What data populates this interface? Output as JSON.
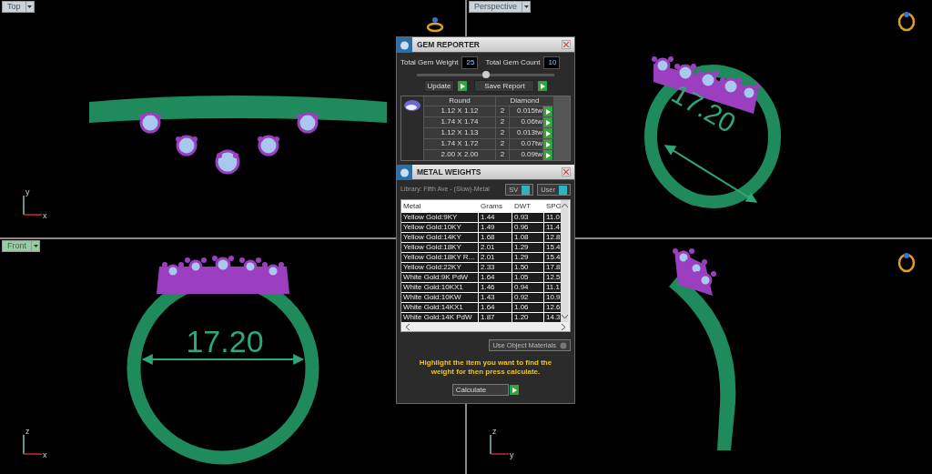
{
  "viewports": [
    {
      "kind": "top",
      "label": "Top",
      "selected": false,
      "axes": [
        "y",
        "x"
      ]
    },
    {
      "kind": "perspective",
      "label": "Perspective",
      "selected": false,
      "dimension": "17.20"
    },
    {
      "kind": "front",
      "label": "Front",
      "selected": true,
      "axes": [
        "z",
        "x"
      ],
      "dimension": "17.20"
    },
    {
      "kind": "right",
      "axes": [
        "z",
        "y"
      ]
    }
  ],
  "gem_reporter": {
    "title": "GEM REPORTER",
    "weight_label": "Total Gem Weight",
    "weight_value": "25",
    "count_label": "Total Gem Count",
    "count_value": "10",
    "slider": {
      "level": 0.5
    },
    "buttons": [
      "Update",
      "Save Report"
    ],
    "columns": [
      "Round",
      "Diamond"
    ],
    "rows": [
      {
        "size": "1.12 X 1.12",
        "count": "2",
        "weight": "0.015tw"
      },
      {
        "size": "1.74 X 1.74",
        "count": "2",
        "weight": "0.06tw"
      },
      {
        "size": "1.12 X 1.13",
        "count": "2",
        "weight": "0.013tw"
      },
      {
        "size": "1.74 X 1.72",
        "count": "2",
        "weight": "0.07tw"
      },
      {
        "size": "2.00 X 2.00",
        "count": "2",
        "weight": "0.09tw"
      }
    ]
  },
  "metal_weights": {
    "title": "METAL WEIGHTS",
    "library": "Library: Fifth Ave - (Slow)-Metal",
    "toggles": [
      "SV",
      "User"
    ],
    "columns": [
      "Metal",
      "Grams",
      "DWT",
      "SPG"
    ],
    "rows": [
      [
        "Yellow Gold:9KY",
        "1.44",
        "0.93",
        "11.0"
      ],
      [
        "Yellow Gold:10KY",
        "1.49",
        "0.96",
        "11.4"
      ],
      [
        "Yellow Gold:14KY",
        "1.68",
        "1.08",
        "12.8"
      ],
      [
        "Yellow Gold:18KY",
        "2.01",
        "1.29",
        "15.4"
      ],
      [
        "Yellow Gold:18KY R...",
        "2.01",
        "1.29",
        "15.4"
      ],
      [
        "Yellow Gold:22KY",
        "2.33",
        "1.50",
        "17.8"
      ],
      [
        "White Gold:9K PdW",
        "1.64",
        "1.05",
        "12.5"
      ],
      [
        "White Gold:10KX1",
        "1.46",
        "0.94",
        "11.1"
      ],
      [
        "White Gold:10KW",
        "1.43",
        "0.92",
        "10.9"
      ],
      [
        "White Gold:14KX1",
        "1.64",
        "1.06",
        "12.6"
      ],
      [
        "White Gold:14K PdW",
        "1.87",
        "1.20",
        "14.3"
      ]
    ],
    "materials_dropdown": "Use Object Materials",
    "message": "Highlight the item you want to find the weight for then press calculate.",
    "calculate": "Calculate"
  }
}
